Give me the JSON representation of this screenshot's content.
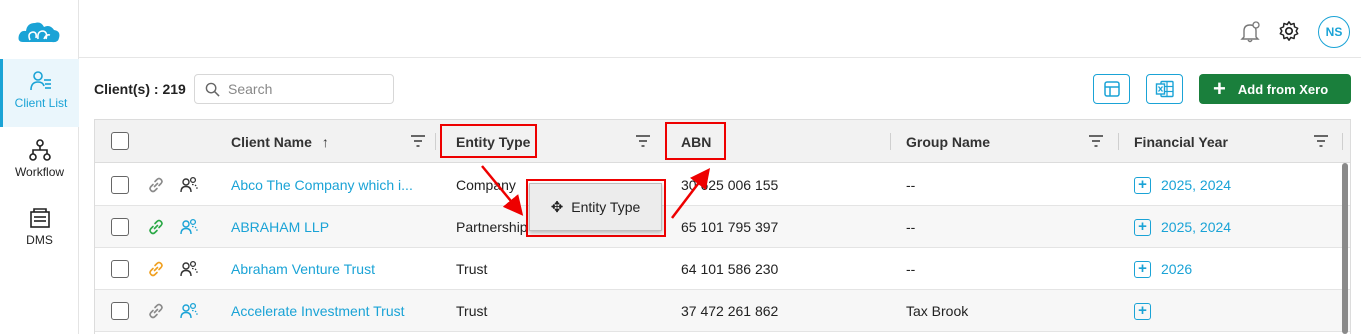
{
  "sidebar": {
    "items": [
      {
        "label": "Client List",
        "icon": "client-list-icon",
        "active": true
      },
      {
        "label": "Workflow",
        "icon": "workflow-icon",
        "active": false
      },
      {
        "label": "DMS",
        "icon": "dms-icon",
        "active": false
      }
    ]
  },
  "header": {
    "avatar_initials": "NS"
  },
  "toolbar": {
    "clients_label": "Client(s) : 219",
    "search_placeholder": "Search",
    "add_from_xero_label": "Add from Xero"
  },
  "table": {
    "columns": [
      "Client Name",
      "Entity Type",
      "ABN",
      "Group Name",
      "Financial Year"
    ],
    "sort_indicator": "↑",
    "rows": [
      {
        "client_name": "Abco The Company which i...",
        "entity_type": "Company",
        "abn": "30 625 006 155",
        "group_name": "--",
        "financial_year": "2025, 2024",
        "link_color": "#8a8a8a",
        "group_color": "#333333"
      },
      {
        "client_name": "ABRAHAM LLP",
        "entity_type": "Partnership",
        "abn": "65 101 795 397",
        "group_name": "--",
        "financial_year": "2025, 2024",
        "link_color": "#2aa846",
        "group_color": "#1aa3d6"
      },
      {
        "client_name": "Abraham Venture Trust",
        "entity_type": "Trust",
        "abn": "64 101 586 230",
        "group_name": "--",
        "financial_year": "2026",
        "link_color": "#f0a020",
        "group_color": "#333333"
      },
      {
        "client_name": "Accelerate Investment Trust",
        "entity_type": "Trust",
        "abn": "37 472 261 862",
        "group_name": "Tax Brook",
        "financial_year": "",
        "link_color": "#8a8a8a",
        "group_color": "#1aa3d6"
      }
    ]
  },
  "drag_chip": {
    "label": "Entity Type"
  },
  "colors": {
    "accent": "#1aa3d6",
    "primary_button": "#1a7f3c",
    "highlight": "#e00000"
  }
}
